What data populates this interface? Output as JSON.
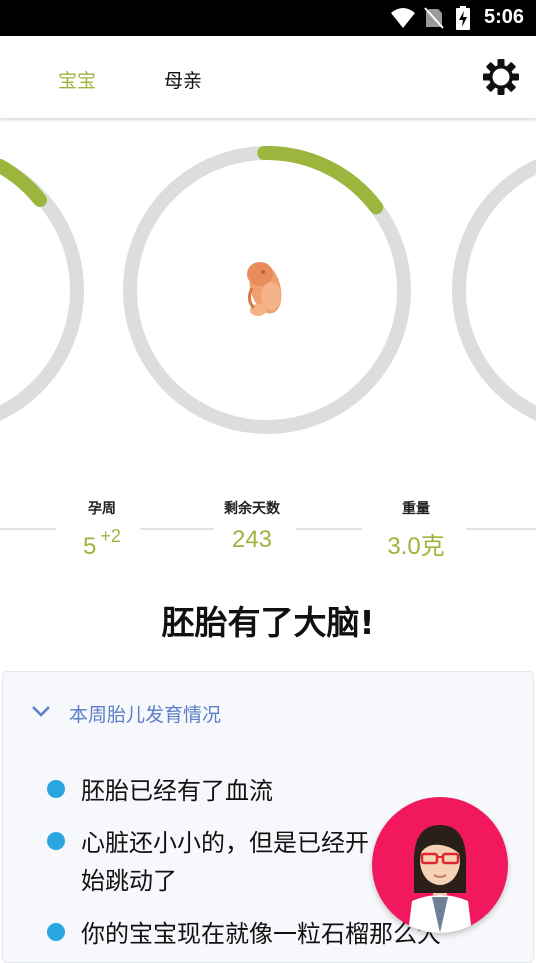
{
  "status_bar": {
    "time": "5:06",
    "icons": [
      "wifi-icon",
      "no-sim-icon",
      "battery-charging-icon"
    ]
  },
  "header": {
    "tabs": [
      {
        "label": "宝宝",
        "active": true
      },
      {
        "label": "母亲",
        "active": false
      }
    ],
    "settings_icon": "gear-icon"
  },
  "colors": {
    "accent_green": "#9bb53d",
    "ring_gray": "#dddddd",
    "link_blue": "#5b7fc9",
    "bullet_blue": "#2aa5df",
    "fab_pink": "#f2185e"
  },
  "progress": {
    "center_ring_fraction": 0.15
  },
  "stats": [
    {
      "label": "孕周",
      "value": "5",
      "sup": "+2"
    },
    {
      "label": "剩余天数",
      "value": "243",
      "sup": ""
    },
    {
      "label": "重量",
      "value": "3.0克",
      "sup": ""
    }
  ],
  "headline": "胚胎有了大脑!",
  "card": {
    "title": "本周胎儿发育情况",
    "expand_icon": "chevron-down-icon",
    "bullets": [
      "胚胎已经有了血流",
      "心脏还小小的，但是已经开始跳动了",
      "你的宝宝现在就像一粒石榴那么大"
    ]
  },
  "assistant": {
    "icon": "doctor-avatar-icon"
  }
}
